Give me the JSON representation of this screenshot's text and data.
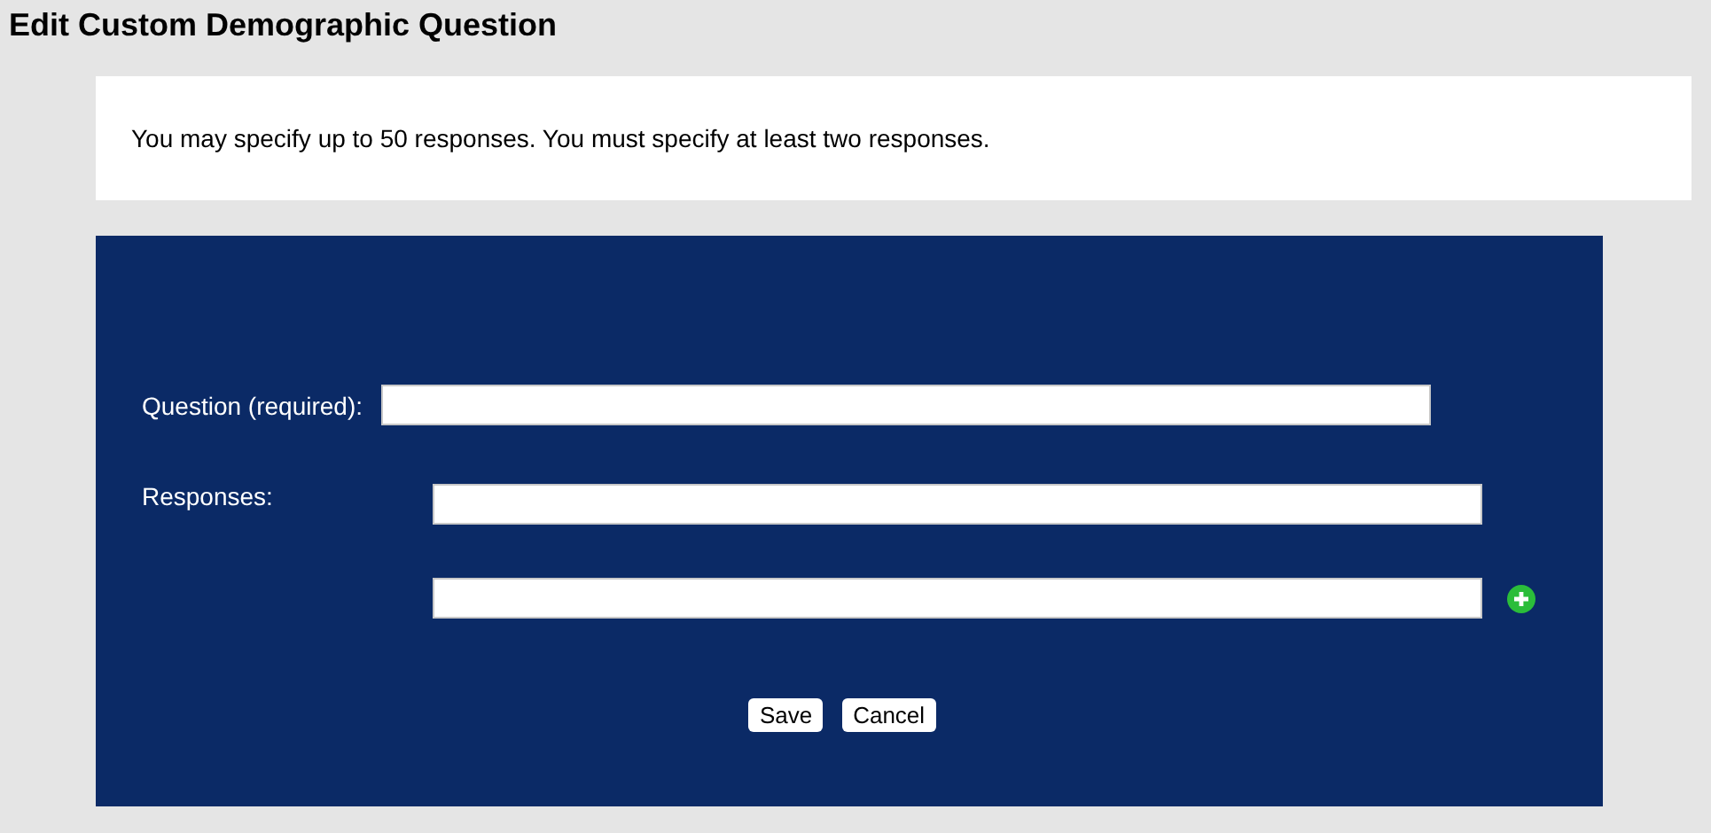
{
  "page": {
    "title": "Edit Custom Demographic Question"
  },
  "notice": "You may specify up to 50 responses. You must specify at least two responses.",
  "question": {
    "label": "Question (required):"
  },
  "responses": {
    "label": "Responses:",
    "fields": [
      {
        "add_button": false
      },
      {
        "add_button": true
      }
    ]
  },
  "buttons": [
    "Save",
    "Cancel"
  ]
}
